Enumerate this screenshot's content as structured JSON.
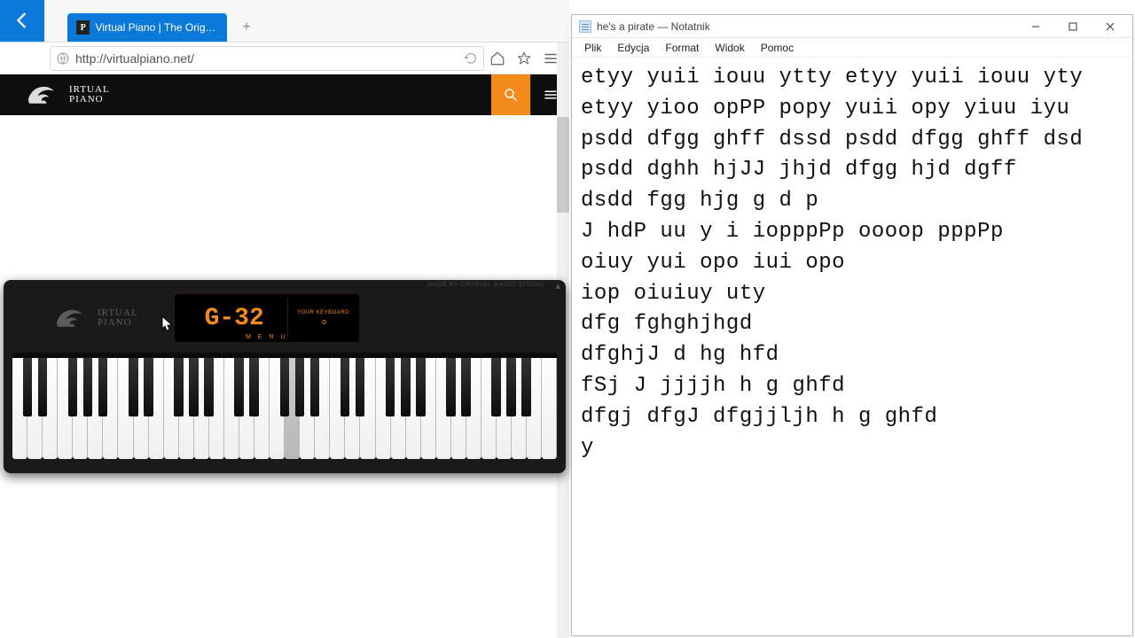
{
  "browser": {
    "tab_title": "Virtual Piano | The Origin...",
    "url": "http://virtualpiano.net/",
    "logo_line1": "IRTUAL",
    "logo_line2": "PIANO"
  },
  "piano": {
    "note": "G-32",
    "your_keyboard_label": "YOUR KEYBOARD:",
    "your_keyboard_key": "o",
    "menu_label": "M E N U",
    "credit": "MADE BY CRYSTAL MAGIC STUDIO",
    "logo_line1": "IRTUAL",
    "logo_line2": "PIANO",
    "white_key_count": 36,
    "pressed_white_index": 18,
    "black_pattern": [
      1,
      1,
      0,
      1,
      1,
      1,
      0
    ]
  },
  "notepad": {
    "title": "he's a pirate — Notatnik",
    "menu": [
      "Plik",
      "Edycja",
      "Format",
      "Widok",
      "Pomoc"
    ],
    "content": "etyy yuii iouu ytty etyy yuii iouu yty etyy yioo opPP popy yuii opy yiuu iyu\npsdd dfgg ghff dssd psdd dfgg ghff dsd psdd dghh hjJJ jhjd dfgg hjd dgff\ndsdd fgg hjg g d p\nJ hdP uu y i iopppPp oooop pppPp\noiuy yui opo iui opo\niop oiuiuy uty\ndfg fghghjhgd\ndfghjJ d hg hfd\nfSj J jjjjh h g ghfd\ndfgj dfgJ dfgjjljh h g ghfd\ny"
  }
}
